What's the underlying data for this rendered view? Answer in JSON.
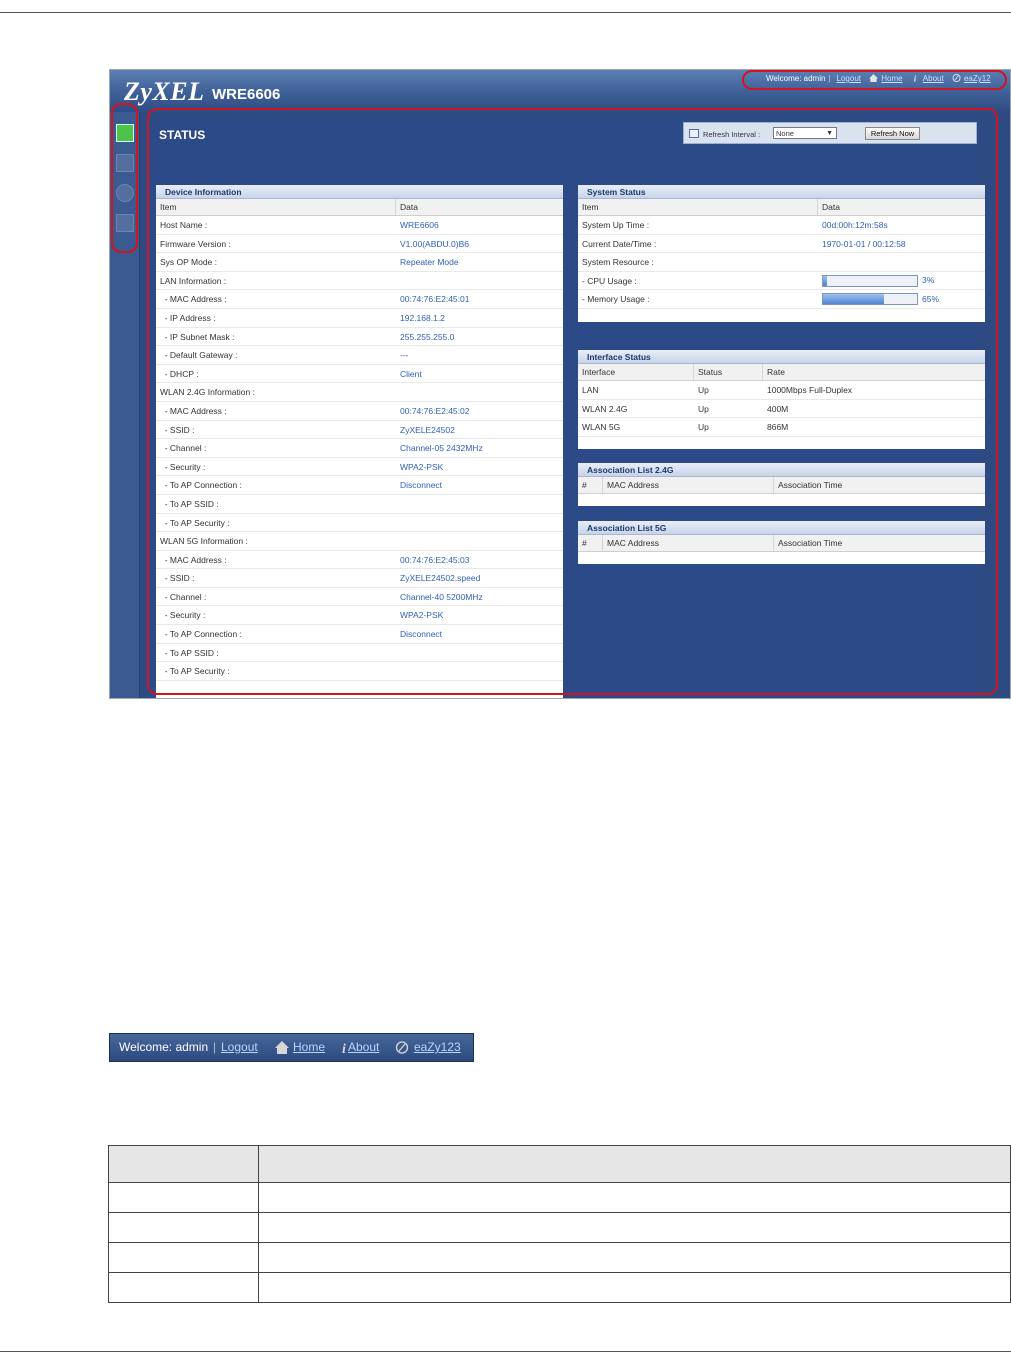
{
  "brand": {
    "logo": "ZyXEL",
    "model": "WRE6606"
  },
  "top_links": {
    "welcome": "Welcome: admin",
    "separator": "|",
    "logout": "Logout",
    "home": "Home",
    "about": "About",
    "wizard": "eaZy12"
  },
  "sidebar": {
    "items": [
      {
        "icon": "dashboard-icon",
        "active": true
      },
      {
        "icon": "monitor-icon",
        "active": false
      },
      {
        "icon": "configuration-icon",
        "active": false
      },
      {
        "icon": "maintenance-icon",
        "active": false
      }
    ]
  },
  "status": {
    "title": "STATUS",
    "refresh_label": "Refresh Interval :",
    "refresh_value": "None",
    "refresh_button": "Refresh Now"
  },
  "device_info": {
    "title": "Device Information",
    "col_item": "Item",
    "col_data": "Data",
    "rows": [
      {
        "item": "Host Name :",
        "data": "WRE6606"
      },
      {
        "item": "Firmware Version :",
        "data": "V1.00(ABDU.0)B6"
      },
      {
        "item": "Sys OP Mode :",
        "data": "Repeater Mode"
      },
      {
        "item": "LAN Information :",
        "data": ""
      },
      {
        "item": "  - MAC Address :",
        "data": "00:74:76:E2:45:01"
      },
      {
        "item": "  - IP Address :",
        "data": "192.168.1.2"
      },
      {
        "item": "  - IP Subnet Mask :",
        "data": "255.255.255.0"
      },
      {
        "item": "  - Default Gateway :",
        "data": "---"
      },
      {
        "item": "  - DHCP :",
        "data": "Client"
      },
      {
        "item": "WLAN 2.4G Information :",
        "data": ""
      },
      {
        "item": "  - MAC Address :",
        "data": "00:74:76:E2:45:02"
      },
      {
        "item": "  - SSID :",
        "data": "ZyXELE24502"
      },
      {
        "item": "  - Channel :",
        "data": "Channel-05 2432MHz"
      },
      {
        "item": "  - Security :",
        "data": "WPA2-PSK"
      },
      {
        "item": "  - To AP Connection :",
        "data": "Disconnect"
      },
      {
        "item": "  - To AP SSID :",
        "data": ""
      },
      {
        "item": "  - To AP Security :",
        "data": ""
      },
      {
        "item": "WLAN 5G Information :",
        "data": ""
      },
      {
        "item": "  - MAC Address :",
        "data": "00:74:76:E2:45:03"
      },
      {
        "item": "  - SSID :",
        "data": "ZyXELE24502.speed"
      },
      {
        "item": "  - Channel :",
        "data": "Channel-40 5200MHz"
      },
      {
        "item": "  - Security :",
        "data": "WPA2-PSK"
      },
      {
        "item": "  - To AP Connection :",
        "data": "Disconnect"
      },
      {
        "item": "  - To AP SSID :",
        "data": ""
      },
      {
        "item": "  - To AP Security :",
        "data": ""
      }
    ]
  },
  "system_status": {
    "title": "System Status",
    "col_item": "Item",
    "col_data": "Data",
    "up_time_label": "System Up Time :",
    "up_time": "00d:00h:12m:58s",
    "date_label": "Current Date/Time :",
    "date": "1970-01-01 / 00:12:58",
    "resource_label": "System Resource :",
    "cpu_label": " - CPU Usage :",
    "cpu_text": "3%",
    "cpu_percent": 3,
    "mem_label": " - Memory Usage :",
    "mem_text": "65%",
    "mem_percent": 65
  },
  "interface_status": {
    "title": "Interface Status",
    "cols": [
      "Interface",
      "Status",
      "Rate"
    ],
    "rows": [
      [
        "LAN",
        "Up",
        "1000Mbps Full-Duplex"
      ],
      [
        "WLAN 2.4G",
        "Up",
        "400M"
      ],
      [
        "WLAN 5G",
        "Up",
        "866M"
      ]
    ]
  },
  "assoc_24": {
    "title": "Association List 2.4G",
    "cols": [
      "#",
      "MAC Address",
      "Association Time"
    ]
  },
  "assoc_5": {
    "title": "Association List 5G",
    "cols": [
      "#",
      "MAC Address",
      "Association Time"
    ]
  },
  "welcome_strip": {
    "welcome": "Welcome: admin",
    "separator": "|",
    "logout": "Logout",
    "home": "Home",
    "about": "About",
    "wizard": "eaZy123"
  },
  "colors": {
    "banner": "#3e5f97",
    "link": "#2e5fb3",
    "callout": "#d3141c"
  }
}
